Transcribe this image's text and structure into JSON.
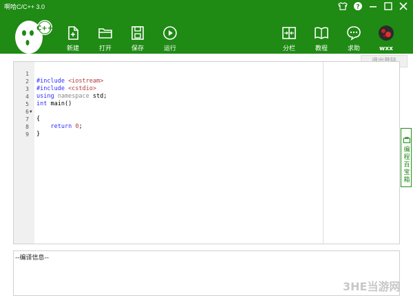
{
  "window": {
    "title": "啊哈C/C++ 3.0",
    "controls": [
      "shirt-icon",
      "help-icon",
      "minimize-icon",
      "maximize-icon",
      "close-icon"
    ]
  },
  "toolbar": {
    "left": [
      {
        "label": "新建",
        "icon": "new-file-icon"
      },
      {
        "label": "打开",
        "icon": "folder-open-icon"
      },
      {
        "label": "保存",
        "icon": "save-icon"
      },
      {
        "label": "运行",
        "icon": "run-icon"
      }
    ],
    "right": [
      {
        "label": "分栏",
        "icon": "split-view-icon"
      },
      {
        "label": "教程",
        "icon": "book-icon"
      },
      {
        "label": "求助",
        "icon": "chat-icon"
      },
      {
        "label": "wxx",
        "icon": "avatar-icon"
      }
    ]
  },
  "user_menu": {
    "logout_label": "退出登陆"
  },
  "editor": {
    "lines": [
      {
        "n": "1",
        "code": "#include <iostream>"
      },
      {
        "n": "2",
        "code": "#include <cstdio>"
      },
      {
        "n": "3",
        "code": "using namespace std;"
      },
      {
        "n": "4",
        "code": "int main()"
      },
      {
        "n": "5",
        "code": "{"
      },
      {
        "n": "6",
        "code": ""
      },
      {
        "n": "7",
        "code": "    return 0;"
      },
      {
        "n": "8",
        "code": "}"
      },
      {
        "n": "9",
        "code": ""
      }
    ]
  },
  "side_tab": {
    "label": "编程百宝箱"
  },
  "output": {
    "header": "--编译信息--"
  },
  "watermark": {
    "text": "3HE当游网"
  },
  "colors": {
    "brand": "#1f8a14",
    "keyword": "#2a2aff",
    "string": "#b53a3a"
  }
}
